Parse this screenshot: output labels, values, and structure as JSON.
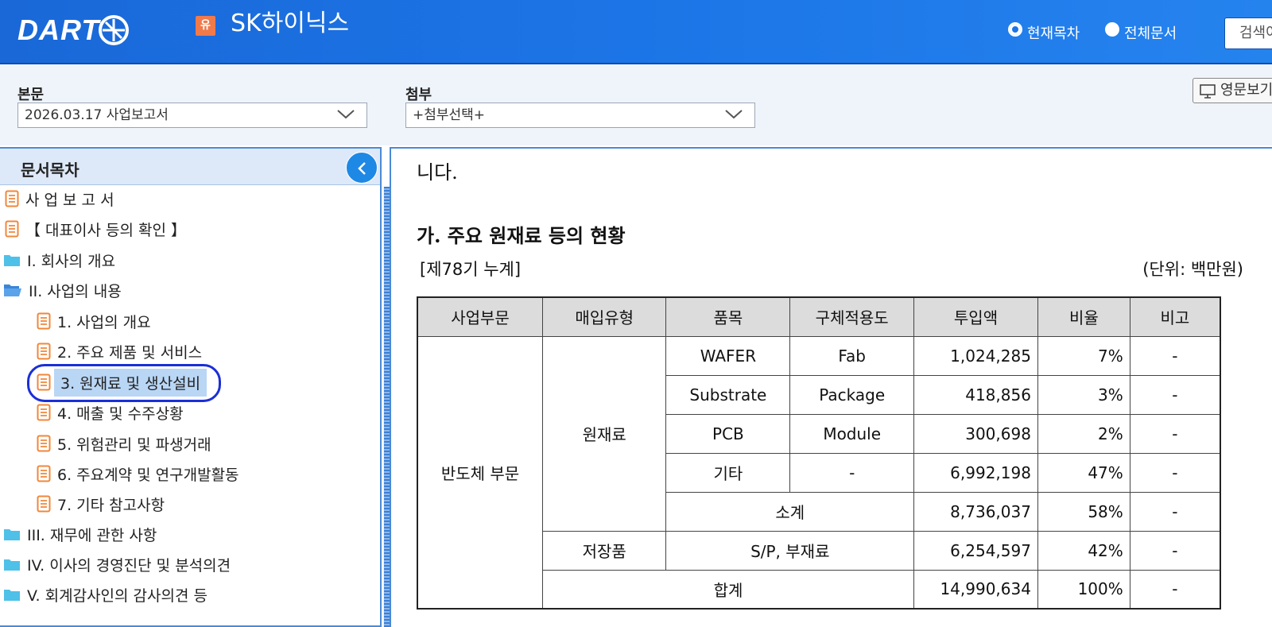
{
  "header": {
    "logo": "DART",
    "corp_badge": "유",
    "corp_name": "SK하이닉스",
    "radio_current": "현재목차",
    "radio_all": "전체문서",
    "search_label": "검색어"
  },
  "selectors": {
    "main_label": "본문",
    "main_value": "2026.03.17   사업보고서",
    "attach_label": "첨부",
    "attach_value": "+첨부선택+",
    "english_btn": "영문보기"
  },
  "toc": {
    "title": "문서목차",
    "items": [
      {
        "label": "사 업 보 고 서"
      },
      {
        "label": "【 대표이사 등의 확인 】"
      },
      {
        "label": "I. 회사의 개요"
      },
      {
        "label": "II. 사업의 내용"
      },
      {
        "label": "1. 사업의 개요"
      },
      {
        "label": "2. 주요 제품 및 서비스"
      },
      {
        "label": "3. 원재료 및 생산설비"
      },
      {
        "label": "4. 매출 및 수주상황"
      },
      {
        "label": "5. 위험관리 및 파생거래"
      },
      {
        "label": "6. 주요계약 및 연구개발활동"
      },
      {
        "label": "7. 기타 참고사항"
      },
      {
        "label": "III. 재무에 관한 사항"
      },
      {
        "label": "IV. 이사의 경영진단 및 분석의견"
      },
      {
        "label": "V. 회계감사인의 감사의견 등"
      }
    ]
  },
  "content": {
    "intro": "니다.",
    "section_title": "가. 주요 원재료 등의 현황",
    "period": "[제78기 누계]",
    "unit": "(단위: 백만원)",
    "table": {
      "headers": [
        "사업부문",
        "매입유형",
        "품목",
        "구체적용도",
        "투입액",
        "비율",
        "비고"
      ],
      "segment": "반도체 부문",
      "type_raw": "원재료",
      "type_stored": "저장품",
      "rows": [
        {
          "item": "WAFER",
          "use": "Fab",
          "amount": "1,024,285",
          "ratio": "7%",
          "note": "-"
        },
        {
          "item": "Substrate",
          "use": "Package",
          "amount": "418,856",
          "ratio": "3%",
          "note": "-"
        },
        {
          "item": "PCB",
          "use": "Module",
          "amount": "300,698",
          "ratio": "2%",
          "note": "-"
        },
        {
          "item": "기타",
          "use": "-",
          "amount": "6,992,198",
          "ratio": "47%",
          "note": "-"
        }
      ],
      "subtotal": {
        "label": "소계",
        "amount": "8,736,037",
        "ratio": "58%",
        "note": "-"
      },
      "stored": {
        "item": "S/P, 부재료",
        "amount": "6,254,597",
        "ratio": "42%",
        "note": "-"
      },
      "total": {
        "label": "합계",
        "amount": "14,990,634",
        "ratio": "100%",
        "note": "-"
      }
    }
  }
}
